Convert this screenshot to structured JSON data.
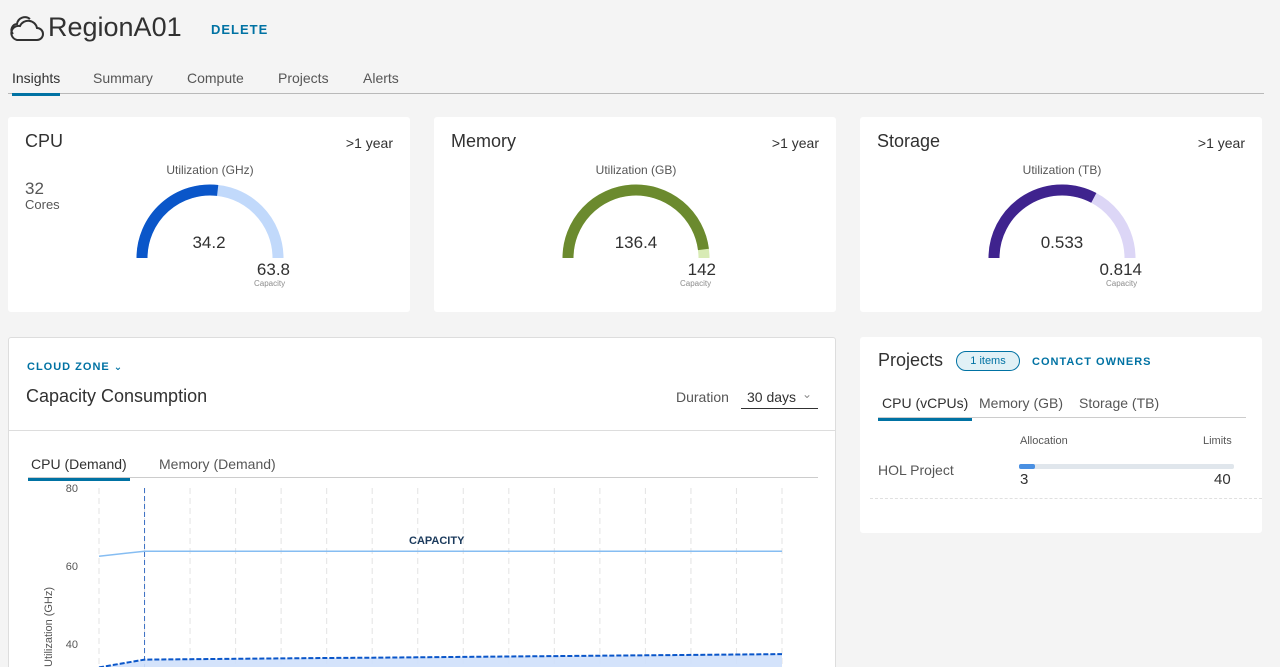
{
  "header": {
    "title": "RegionA01",
    "delete_label": "DELETE"
  },
  "tabs": [
    {
      "label": "Insights",
      "active": true
    },
    {
      "label": "Summary"
    },
    {
      "label": "Compute"
    },
    {
      "label": "Projects"
    },
    {
      "label": "Alerts"
    }
  ],
  "cards": {
    "cpu": {
      "title": "CPU",
      "period": ">1 year",
      "extra_value": "32",
      "extra_label": "Cores",
      "gauge_label": "Utilization (GHz)",
      "value": "34.2",
      "capacity": "63.8",
      "capacity_label": "Capacity",
      "fraction": 0.536,
      "color": "#0a56c9",
      "track_color": "#c1d9fb"
    },
    "memory": {
      "title": "Memory",
      "period": ">1 year",
      "gauge_label": "Utilization (GB)",
      "value": "136.4",
      "capacity": "142",
      "capacity_label": "Capacity",
      "fraction": 0.96,
      "color": "#6b8a2e",
      "track_color": "#d8ebb5"
    },
    "storage": {
      "title": "Storage",
      "period": ">1 year",
      "gauge_label": "Utilization (TB)",
      "value": "0.533",
      "capacity": "0.814",
      "capacity_label": "Capacity",
      "fraction": 0.655,
      "color": "#3f238e",
      "track_color": "#dcd6f6"
    }
  },
  "capacity": {
    "zone_label": "CLOUD ZONE",
    "title": "Capacity Consumption",
    "duration_label": "Duration",
    "duration_value": "30 days",
    "sub_tabs": [
      {
        "label": "CPU (Demand)",
        "active": true
      },
      {
        "label": "Memory (Demand)"
      }
    ],
    "capacity_annotation": "CAPACITY",
    "y_axis_label": "Utilization (GHz)"
  },
  "chart_data": {
    "type": "area",
    "ylabel": "Utilization (GHz)",
    "ylim": [
      0,
      80
    ],
    "y_ticks": [
      40,
      60,
      80
    ],
    "grid": true,
    "annotations": [
      "CAPACITY"
    ],
    "series": [
      {
        "values": [
          62.5,
          63.8,
          63.8,
          63.8,
          63.8,
          63.8,
          63.8,
          63.8,
          63.8,
          63.8,
          63.8,
          63.8,
          63.8,
          63.8,
          63.8,
          63.8
        ],
        "color": "#86bdf2"
      },
      {
        "values": [
          34,
          36,
          36.1,
          36.2,
          36.3,
          36.4,
          36.5,
          36.6,
          36.7,
          36.8,
          36.9,
          37,
          37.1,
          37.2,
          37.3,
          37.4
        ],
        "color": "#0a56c9"
      }
    ]
  },
  "projects": {
    "title": "Projects",
    "badge": "1 items",
    "contact_label": "CONTACT OWNERS",
    "tabs": [
      {
        "label": "CPU (vCPUs)",
        "active": true
      },
      {
        "label": "Memory (GB)"
      },
      {
        "label": "Storage (TB)"
      }
    ],
    "col_allocation": "Allocation",
    "col_limits": "Limits",
    "rows": [
      {
        "name": "HOL Project",
        "allocation": "3",
        "limit": "40",
        "fraction": 0.075
      }
    ]
  },
  "colors": {
    "accent": "#0072a3",
    "background": "#f4f4f4"
  }
}
